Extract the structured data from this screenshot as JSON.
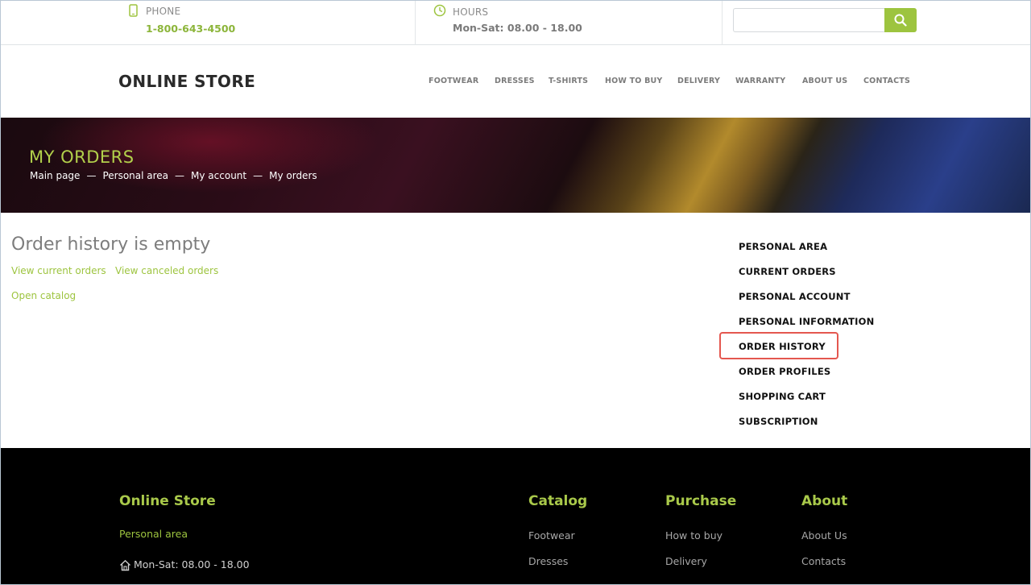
{
  "topbar": {
    "phone_label": "PHONE",
    "phone_value": "1-800-643-4500",
    "hours_label": "HOURS",
    "hours_value": "Mon-Sat: 08.00 - 18.00",
    "search_placeholder": "",
    "search_value": ""
  },
  "header": {
    "logo": "ONLINE STORE",
    "nav": [
      "FOOTWEAR",
      "DRESSES",
      "T-SHIRTS",
      "HOW TO BUY",
      "DELIVERY",
      "WARRANTY",
      "ABOUT US",
      "CONTACTS"
    ]
  },
  "banner": {
    "title": "MY ORDERS",
    "breadcrumbs": [
      "Main page",
      "Personal area",
      "My account",
      "My orders"
    ],
    "separator": "—"
  },
  "main": {
    "heading": "Order history is empty",
    "link_current": "View current orders",
    "link_canceled": "View canceled orders",
    "link_catalog": "Open catalog"
  },
  "side_menu": {
    "items": [
      "PERSONAL AREA",
      "CURRENT ORDERS",
      "PERSONAL ACCOUNT",
      "PERSONAL INFORMATION",
      "ORDER HISTORY",
      "ORDER PROFILES",
      "SHOPPING CART",
      "SUBSCRIPTION"
    ],
    "highlighted": "ORDER HISTORY"
  },
  "footer": {
    "store_title": "Online Store",
    "store_link": "Personal area",
    "store_hours": "Mon-Sat: 08.00 - 18.00",
    "catalog_title": "Catalog",
    "catalog_links": [
      "Footwear",
      "Dresses"
    ],
    "purchase_title": "Purchase",
    "purchase_links": [
      "How to buy",
      "Delivery"
    ],
    "about_title": "About",
    "about_links": [
      "About Us",
      "Contacts"
    ]
  },
  "colors": {
    "accent": "#9dc43f",
    "highlight_border": "#e4574f",
    "footer_bg": "#000000"
  },
  "icons": [
    "phone-icon",
    "clock-icon",
    "search-icon",
    "home-icon"
  ]
}
